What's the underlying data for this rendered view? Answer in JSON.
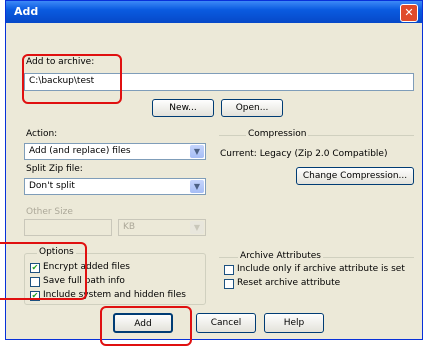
{
  "window": {
    "title": "Add"
  },
  "add_to_archive": {
    "label": "Add to archive:",
    "value": "C:\\backup\\test",
    "new_button": "New...",
    "open_button": "Open..."
  },
  "action": {
    "label": "Action:",
    "selected": "Add (and replace) files"
  },
  "compression": {
    "group_label": "Compression",
    "current_text": "Current: Legacy (Zip 2.0 Compatible)",
    "change_button": "Change Compression..."
  },
  "split": {
    "label": "Split Zip file:",
    "selected": "Don't split",
    "other_size_label": "Other Size",
    "unit_selected": "KB"
  },
  "options": {
    "group_label": "Options",
    "items": [
      {
        "label": "Encrypt added files",
        "checked": true
      },
      {
        "label": "Save full path info",
        "checked": false
      },
      {
        "label": "Include system and hidden files",
        "checked": true
      }
    ]
  },
  "archive_attributes": {
    "group_label": "Archive Attributes",
    "items": [
      {
        "label": "Include only if archive attribute is set",
        "checked": false
      },
      {
        "label": "Reset archive attribute",
        "checked": false
      }
    ]
  },
  "buttons": {
    "add": "Add",
    "cancel": "Cancel",
    "help": "Help"
  },
  "colors": {
    "titlebar": "#0a5be0",
    "highlight": "#e01010",
    "dialog_bg": "#ece9d8"
  }
}
